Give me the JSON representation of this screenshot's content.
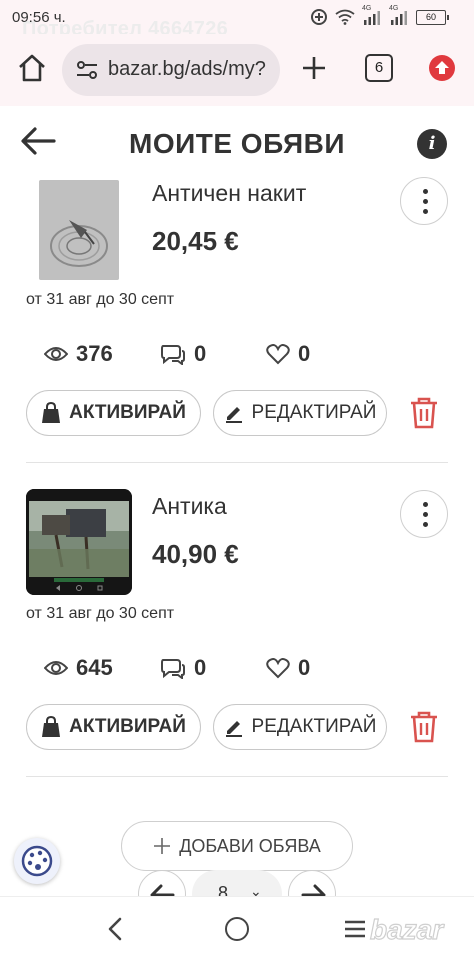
{
  "status_bar": {
    "time": "09:56 ч.",
    "ghost_text": "Потребител 4664726",
    "battery": "60",
    "signal_label_1": "4G",
    "signal_label_2": "4G"
  },
  "browser": {
    "url": "bazar.bg/ads/my?",
    "tab_count": "6"
  },
  "header": {
    "title": "МОИТЕ ОБЯВИ",
    "info_label": "i"
  },
  "ads": [
    {
      "title": "Античен накит",
      "price": "20,45 €",
      "period": "от 31 авг до 30 септ",
      "views": "376",
      "messages": "0",
      "favorites": "0",
      "activate_label": "АКТИВИРАЙ",
      "edit_label": "РЕДАКТИРАЙ"
    },
    {
      "title": "Антика",
      "price": "40,90 €",
      "period": "от 31 авг до 30 септ",
      "views": "645",
      "messages": "0",
      "favorites": "0",
      "activate_label": "АКТИВИРАЙ",
      "edit_label": "РЕДАКТИРАЙ"
    }
  ],
  "footer": {
    "add_ad_label": "ДОБАВИ ОБЯВА",
    "page_value": "8"
  },
  "watermark": "bazar",
  "colors": {
    "delete_red": "#d9534f",
    "update_red": "#e0393e",
    "chrome_bg": "#fdf4f6"
  }
}
